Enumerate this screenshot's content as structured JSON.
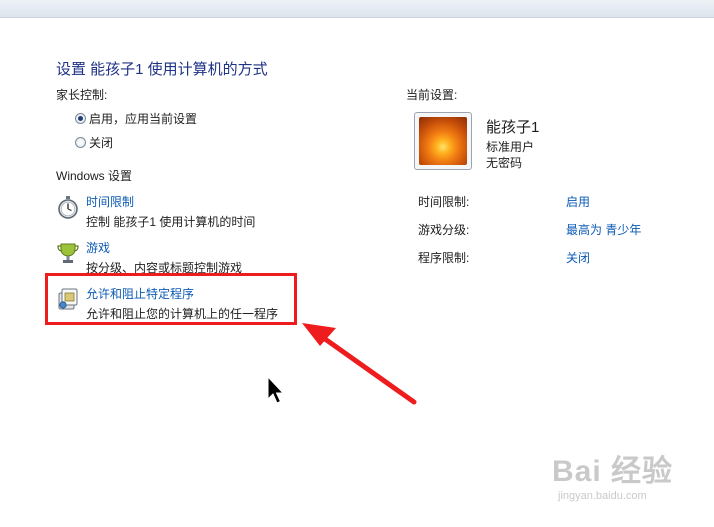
{
  "title": "设置 能孩子1 使用计算机的方式",
  "parental_controls": {
    "label": "家长控制:",
    "options": [
      "启用，应用当前设置",
      "关闭"
    ],
    "selected": "启用，应用当前设置"
  },
  "windows_settings": {
    "label": "Windows 设置",
    "items": [
      {
        "title": "时间限制",
        "desc": "控制 能孩子1 使用计算机的时间",
        "icon": "stopwatch-icon"
      },
      {
        "title": "游戏",
        "desc": "按分级、内容或标题控制游戏",
        "icon": "trophy-icon"
      },
      {
        "title": "允许和阻止特定程序",
        "desc": "允许和阻止您的计算机上的任一程序",
        "icon": "programs-icon"
      }
    ]
  },
  "current_settings": {
    "label": "当前设置:",
    "user_name": "能孩子1",
    "account_type": "标准用户",
    "password_status": "无密码",
    "rows": [
      {
        "label": "时间限制:",
        "value": "启用"
      },
      {
        "label": "游戏分级:",
        "value": "最高为 青少年"
      },
      {
        "label": "程序限制:",
        "value": "关闭"
      }
    ]
  },
  "watermark": {
    "brand": "Bai 经验",
    "url": "jingyan.baidu.com"
  },
  "colors": {
    "link": "#0d5bb5",
    "title": "#1e3287",
    "highlight": "#ee1c1c"
  }
}
